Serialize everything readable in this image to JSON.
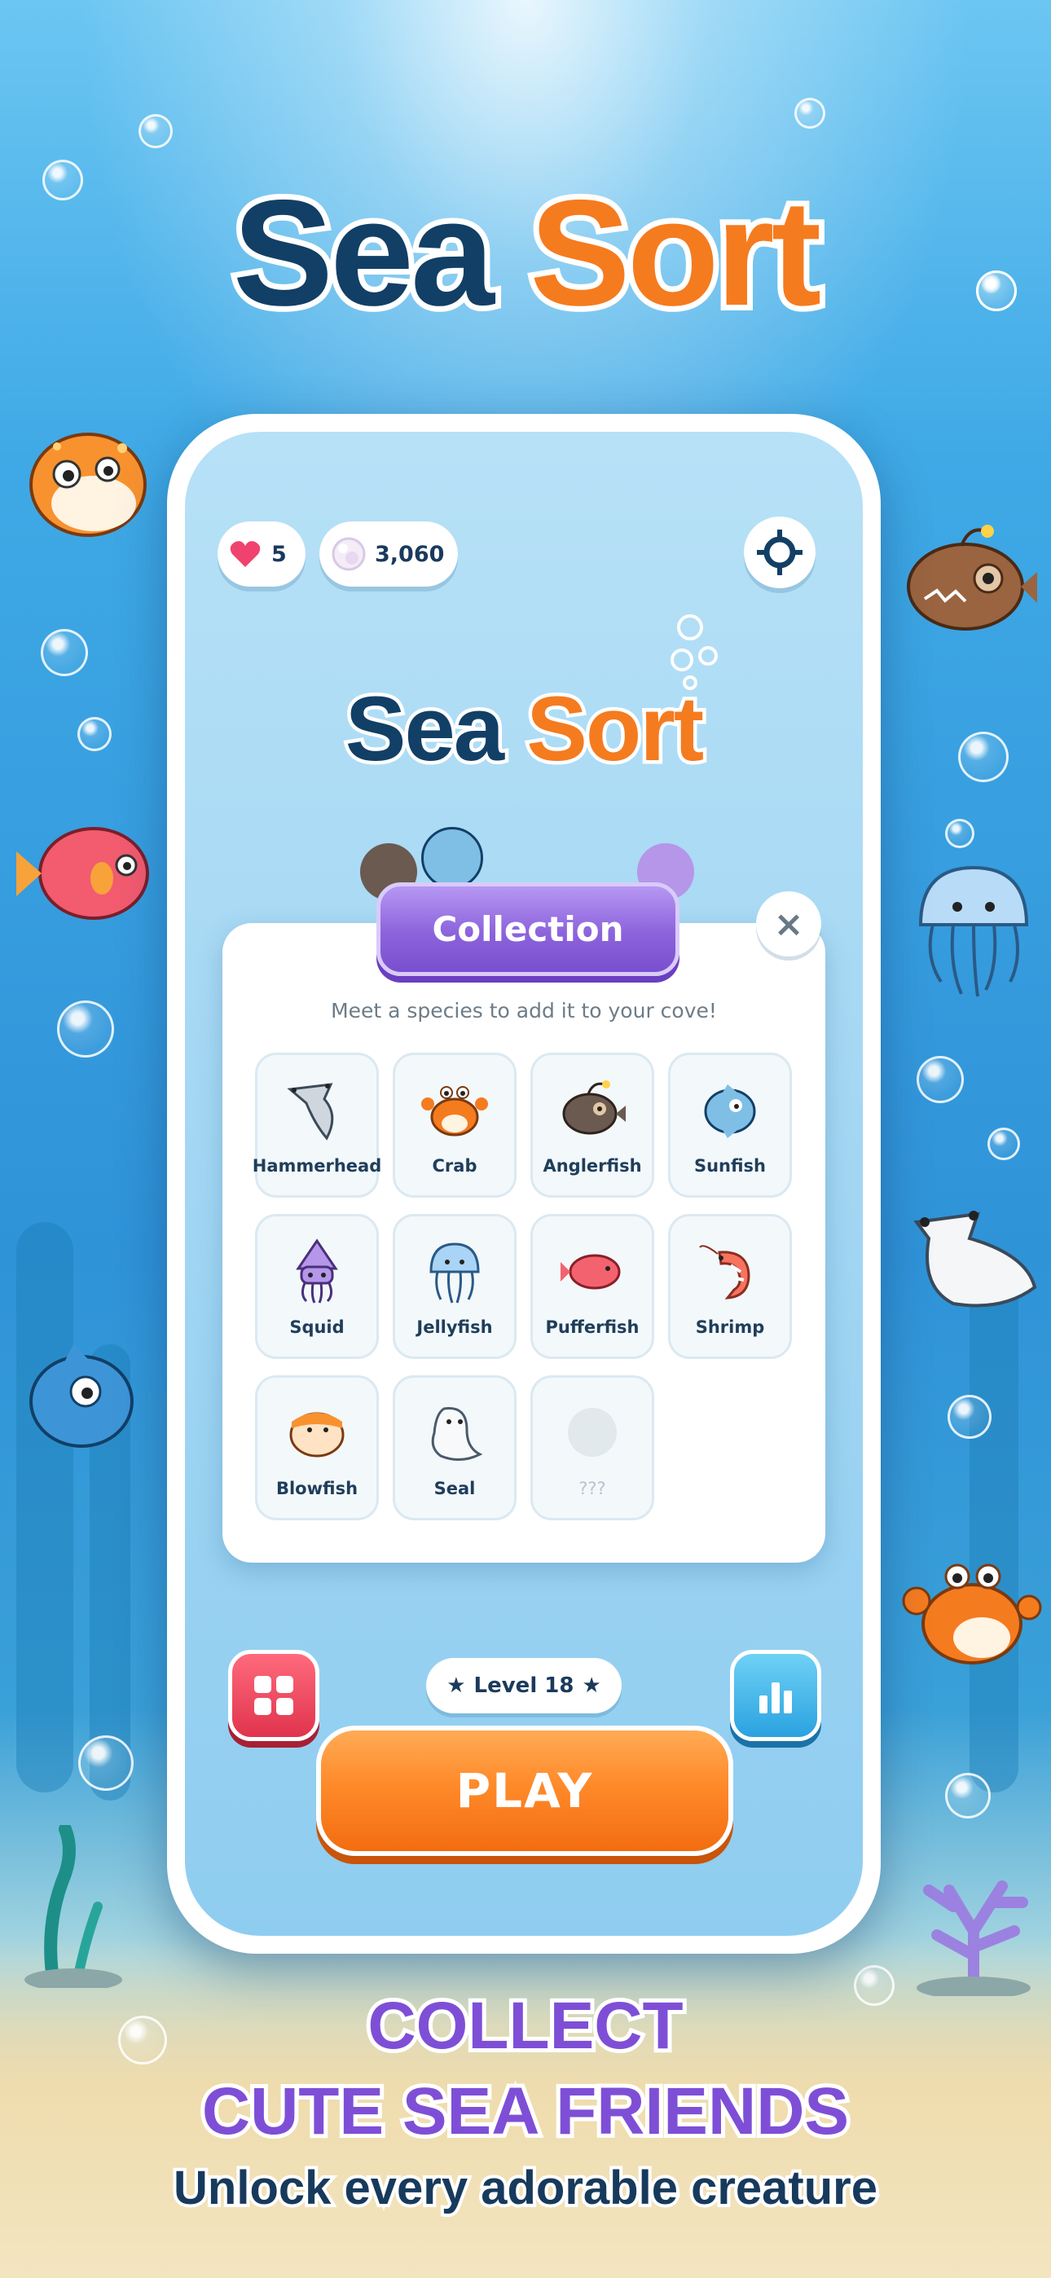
{
  "app": {
    "title_part1": "Sea",
    "title_part2": "Sort"
  },
  "status_bar": {
    "lives": "5",
    "pearls": "3,060"
  },
  "icons": {
    "heart": "heart-icon",
    "pearl": "pearl-icon",
    "settings": "settings-icon",
    "close": "close-icon",
    "grid": "grid-icon",
    "stats": "bar-chart-icon",
    "star": "star-icon"
  },
  "collection": {
    "title": "Collection",
    "close_label": "×",
    "subtitle": "Meet a species to add it to your cove!",
    "items": [
      {
        "label": "Hammerhead",
        "icon": "hammerhead-icon",
        "locked": false
      },
      {
        "label": "Crab",
        "icon": "crab-icon",
        "locked": false
      },
      {
        "label": "Anglerfish",
        "icon": "anglerfish-icon",
        "locked": false
      },
      {
        "label": "Sunfish",
        "icon": "sunfish-icon",
        "locked": false
      },
      {
        "label": "Squid",
        "icon": "squid-icon",
        "locked": false
      },
      {
        "label": "Jellyfish",
        "icon": "jellyfish-icon",
        "locked": false
      },
      {
        "label": "Pufferfish",
        "icon": "pufferfish-icon",
        "locked": false
      },
      {
        "label": "Shrimp",
        "icon": "shrimp-icon",
        "locked": false
      },
      {
        "label": "Blowfish",
        "icon": "blowfish-icon",
        "locked": false
      },
      {
        "label": "Seal",
        "icon": "seal-icon",
        "locked": false
      },
      {
        "label": "???",
        "icon": "locked-slot-icon",
        "locked": true
      }
    ]
  },
  "level": {
    "label": "Level 18"
  },
  "play_button": {
    "label": "PLAY"
  },
  "promo": {
    "line1": "COLLECT",
    "line2": "CUTE SEA FRIENDS",
    "line3": "Unlock every adorable creature"
  },
  "colors": {
    "accent_orange": "#f57b1f",
    "title_navy": "#123f66",
    "collection_purple": "#8c63dc",
    "grid_button_red": "#f2465e",
    "stats_button_blue": "#3cb4ea",
    "heart_pink": "#f0426e"
  }
}
